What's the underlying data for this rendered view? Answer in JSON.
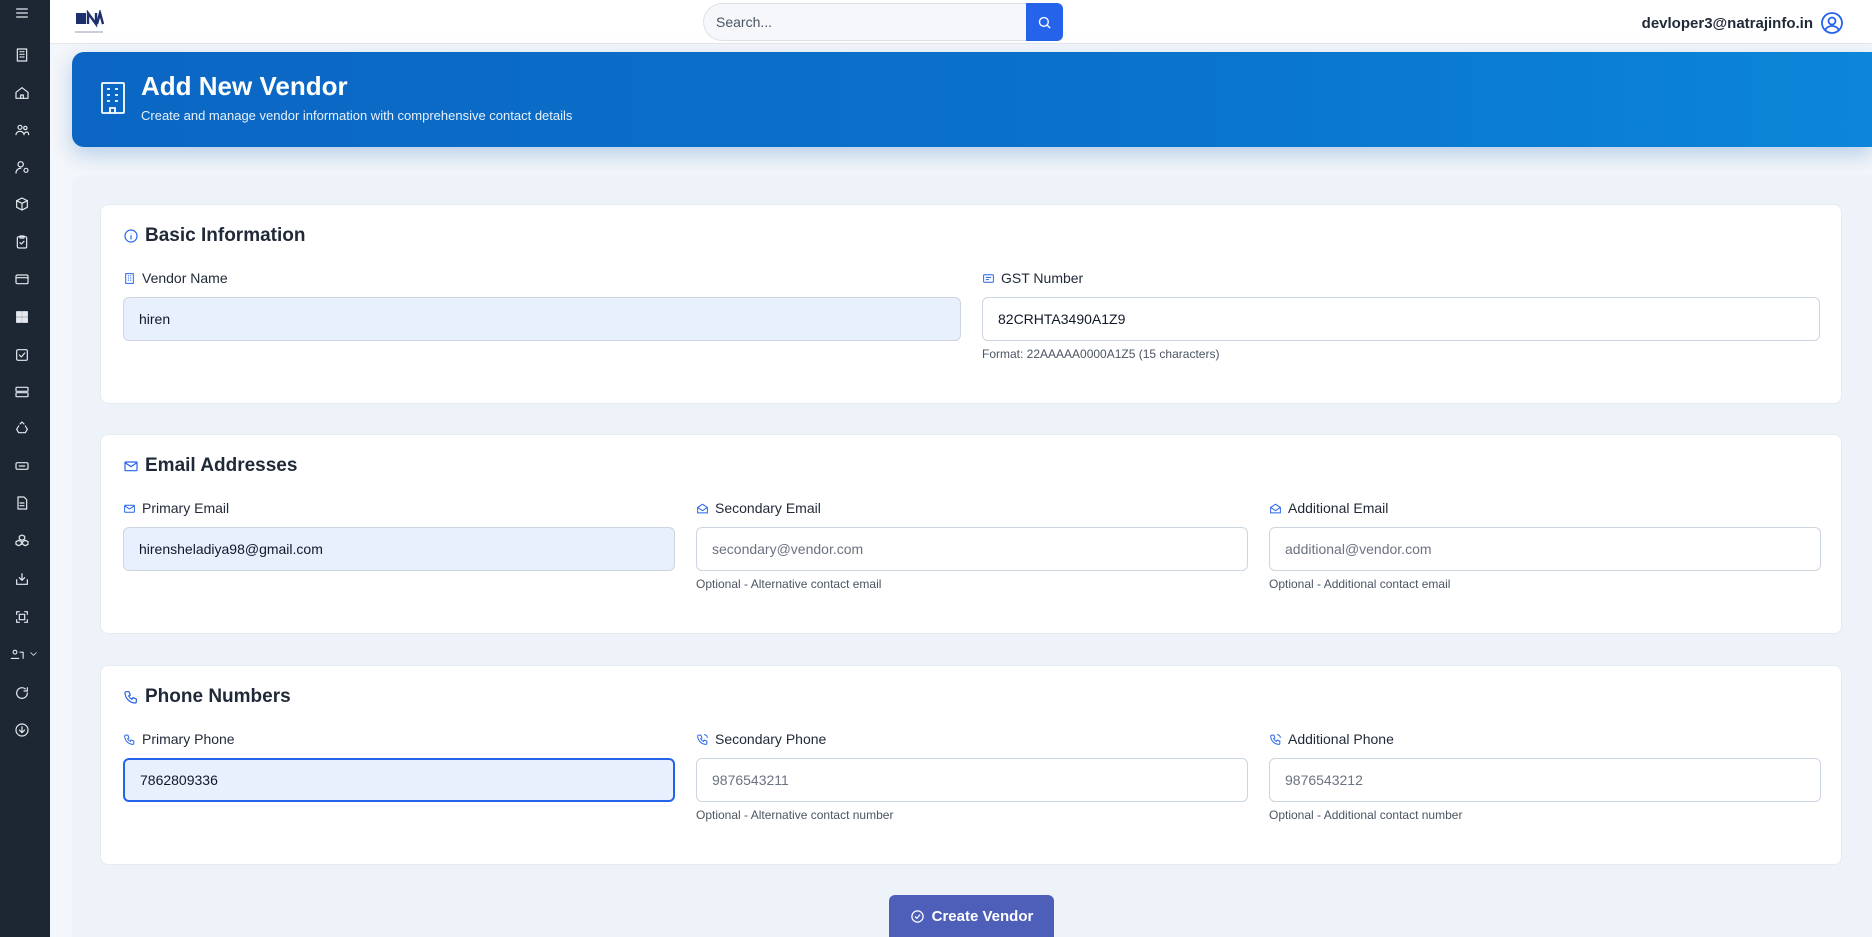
{
  "topbar": {
    "search_placeholder": "Search...",
    "user_email": "devloper3@natrajinfo.in"
  },
  "header": {
    "title": "Add New Vendor",
    "subtitle": "Create and manage vendor information with comprehensive contact details"
  },
  "basic": {
    "title": "Basic Information",
    "vendor_name_label": "Vendor Name",
    "vendor_name_value": "hiren",
    "gst_label": "GST Number",
    "gst_value": "82CRHTA3490A1Z9",
    "gst_hint": "Format: 22AAAAA0000A1Z5 (15 characters)"
  },
  "emails": {
    "title": "Email Addresses",
    "primary_label": "Primary Email",
    "primary_value": "hirensheladiya98@gmail.com",
    "secondary_label": "Secondary Email",
    "secondary_placeholder": "secondary@vendor.com",
    "secondary_hint": "Optional - Alternative contact email",
    "additional_label": "Additional Email",
    "additional_placeholder": "additional@vendor.com",
    "additional_hint": "Optional - Additional contact email"
  },
  "phones": {
    "title": "Phone Numbers",
    "primary_label": "Primary Phone",
    "primary_value": "7862809336",
    "secondary_label": "Secondary Phone",
    "secondary_placeholder": "9876543211",
    "secondary_hint": "Optional - Alternative contact number",
    "additional_label": "Additional Phone",
    "additional_placeholder": "9876543212",
    "additional_hint": "Optional - Additional contact number"
  },
  "actions": {
    "create_label": "Create Vendor"
  },
  "colors": {
    "sidebar": "#1c2733",
    "accent": "#2563eb",
    "banner": "#0b66c3",
    "create_button": "#4d5fb8"
  },
  "sidebar_icons": [
    "menu-icon",
    "building-icon",
    "home-icon",
    "users-icon",
    "user-settings-icon",
    "box-icon",
    "clipboard-check-icon",
    "credit-card-icon",
    "dashboard-icon",
    "checklist-icon",
    "server-icon",
    "recycle-icon",
    "ticket-icon",
    "document-icon",
    "cubes-icon",
    "inbox-download-icon",
    "scan-icon",
    "team-dropdown-icon",
    "refresh-icon",
    "download-circle-icon"
  ]
}
